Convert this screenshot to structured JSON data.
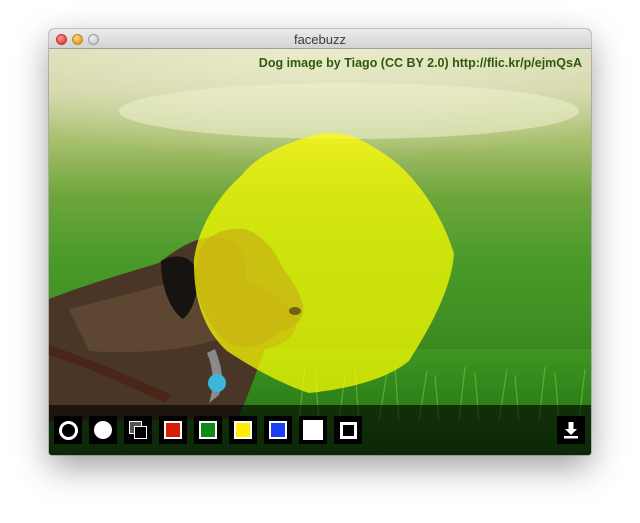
{
  "window": {
    "title": "facebuzz"
  },
  "image": {
    "credit": "Dog image by Tiago (CC BY 2.0) http://flic.kr/p/ejmQsA"
  },
  "toolbar": {
    "tools": [
      {
        "name": "brush-ring-icon"
      },
      {
        "name": "brush-solid-icon"
      },
      {
        "name": "layers-icon"
      },
      {
        "name": "color-swatch-red",
        "color": "#d81e05"
      },
      {
        "name": "color-swatch-green",
        "color": "#0e8a16"
      },
      {
        "name": "color-swatch-yellow",
        "color": "#ffee00"
      },
      {
        "name": "color-swatch-blue",
        "color": "#1c3ff5"
      },
      {
        "name": "color-swatch-white",
        "color": "#ffffff"
      },
      {
        "name": "color-swatch-black",
        "color": "#000000"
      }
    ],
    "download_icon": "download-icon"
  },
  "overlay": {
    "fill_color": "#ffff00"
  }
}
